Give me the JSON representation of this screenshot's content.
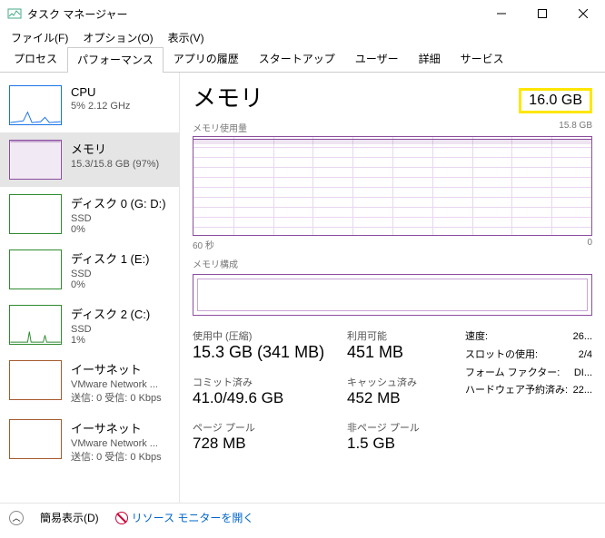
{
  "window": {
    "title": "タスク マネージャー"
  },
  "menu": {
    "file": "ファイル(F)",
    "options": "オプション(O)",
    "view": "表示(V)"
  },
  "tabs": [
    "プロセス",
    "パフォーマンス",
    "アプリの履歴",
    "スタートアップ",
    "ユーザー",
    "詳細",
    "サービス"
  ],
  "active_tab": 1,
  "sidebar": [
    {
      "title": "CPU",
      "sub": "5%  2.12 GHz",
      "color": "#1a73e8",
      "selected": false,
      "kind": "cpu"
    },
    {
      "title": "メモリ",
      "sub": "15.3/15.8 GB (97%)",
      "color": "#8b4e9f",
      "selected": true,
      "kind": "memory"
    },
    {
      "title": "ディスク 0 (G: D:)",
      "sub": "SSD",
      "sub2": "0%",
      "color": "#2e8b2e",
      "selected": false,
      "kind": "disk"
    },
    {
      "title": "ディスク 1 (E:)",
      "sub": "SSD",
      "sub2": "0%",
      "color": "#2e8b2e",
      "selected": false,
      "kind": "disk"
    },
    {
      "title": "ディスク 2 (C:)",
      "sub": "SSD",
      "sub2": "1%",
      "color": "#2e8b2e",
      "selected": false,
      "kind": "disk-active"
    },
    {
      "title": "イーサネット",
      "sub": "VMware Network ...",
      "sub2": "送信: 0 受信: 0 Kbps",
      "color": "#a65a2e",
      "selected": false,
      "kind": "net"
    },
    {
      "title": "イーサネット",
      "sub": "VMware Network ...",
      "sub2": "送信: 0 受信: 0 Kbps",
      "color": "#a65a2e",
      "selected": false,
      "kind": "net"
    }
  ],
  "main": {
    "title": "メモリ",
    "total": "16.0 GB",
    "usage_label": "メモリ使用量",
    "usage_max": "15.8 GB",
    "axis_left": "60 秒",
    "axis_right": "0",
    "composition_label": "メモリ構成",
    "stats": {
      "in_use_label": "使用中 (圧縮)",
      "in_use": "15.3 GB (341 MB)",
      "available_label": "利用可能",
      "available": "451 MB",
      "committed_label": "コミット済み",
      "committed": "41.0/49.6 GB",
      "cached_label": "キャッシュ済み",
      "cached": "452 MB",
      "paged_label": "ページ プール",
      "paged": "728 MB",
      "nonpaged_label": "非ページ プール",
      "nonpaged": "1.5 GB"
    },
    "details": {
      "speed_label": "速度:",
      "speed": "26...",
      "slots_label": "スロットの使用:",
      "slots": "2/4",
      "form_label": "フォーム ファクター:",
      "form": "DI...",
      "reserved_label": "ハードウェア予約済み:",
      "reserved": "22..."
    }
  },
  "footer": {
    "simple": "簡易表示(D)",
    "resmon": "リソース モニターを開く"
  }
}
